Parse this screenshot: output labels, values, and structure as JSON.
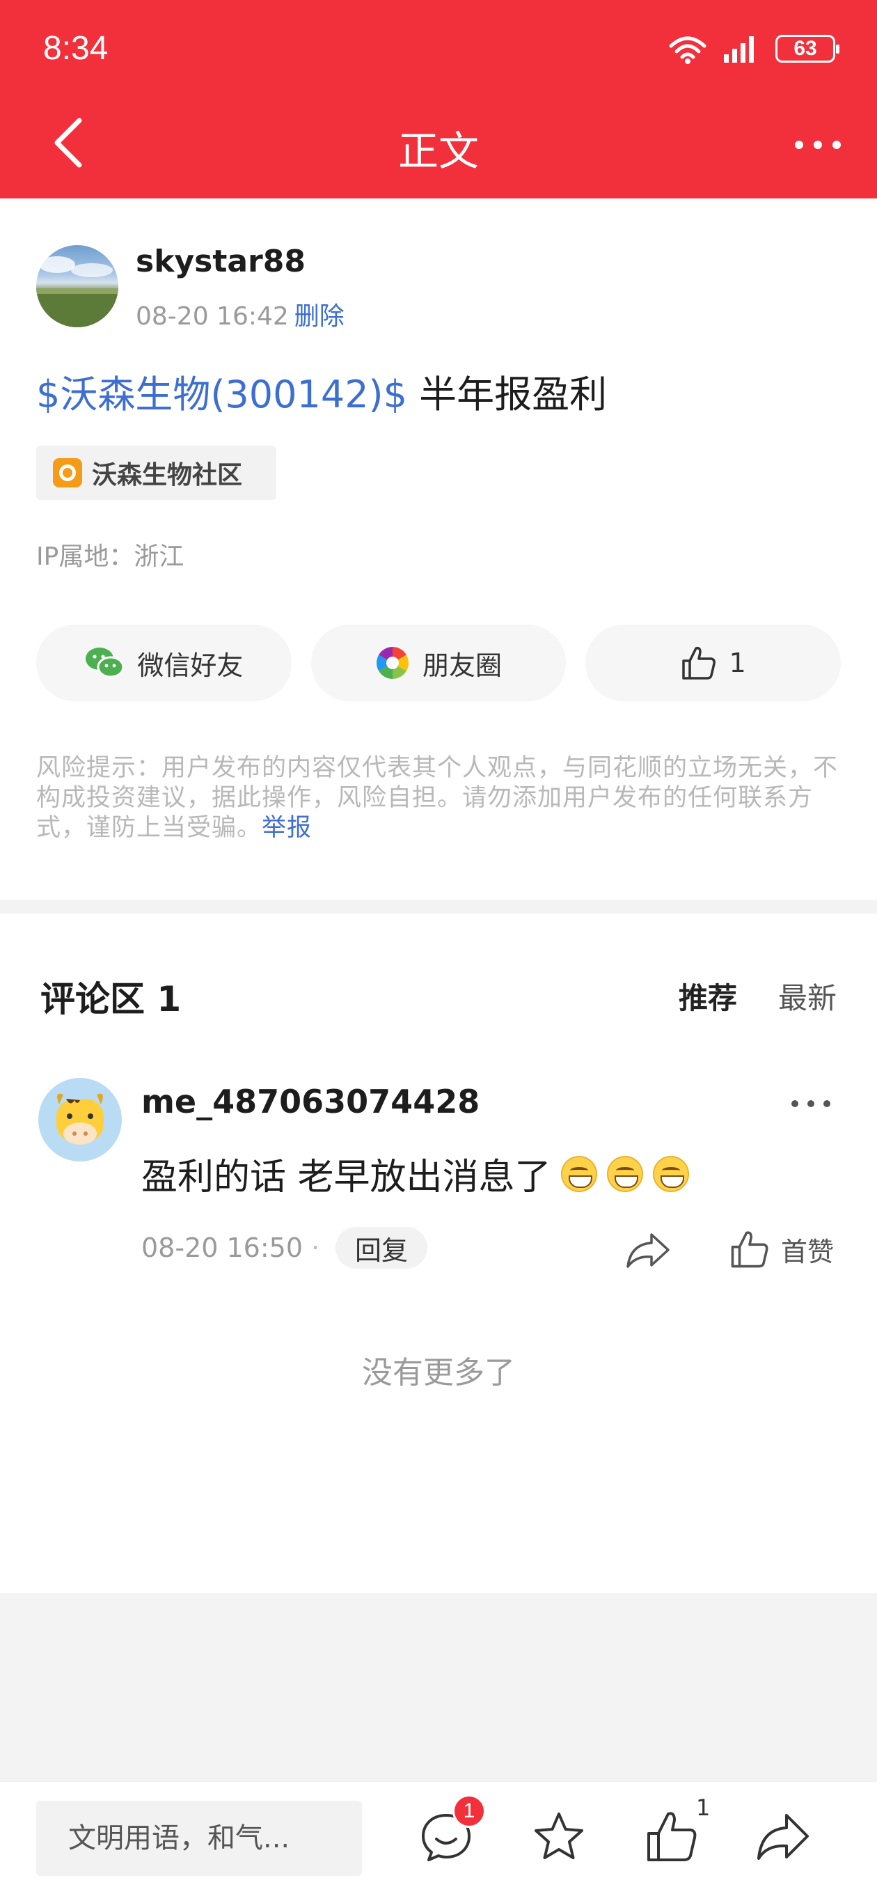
{
  "status_bar": {
    "time": "8:34",
    "battery": "63"
  },
  "nav": {
    "title": "正文"
  },
  "post": {
    "author": "skystar88",
    "date": "08-20 16:42",
    "delete_label": "删除",
    "stock_tag": "$沃森生物(300142)$",
    "title_text": " 半年报盈利",
    "community": "沃森生物社区",
    "ip_location": "IP属地：浙江"
  },
  "share": {
    "wechat": "微信好友",
    "moments": "朋友圈",
    "like_count": "1"
  },
  "risk_notice": {
    "text": "风险提示：用户发布的内容仅代表其个人观点，与同花顺的立场无关，不构成投资建议，据此操作，风险自担。请勿添加用户发布的任何联系方式，谨防上当受骗。",
    "report_label": "举报"
  },
  "comments": {
    "title": "评论区 1",
    "sort_recommended": "推荐",
    "sort_latest": "最新",
    "items": [
      {
        "user": "me_487063074428",
        "text": "盈利的话 老早放出消息了",
        "time": "08-20 16:50",
        "separator": "·",
        "reply_label": "回复",
        "like_label": "首赞"
      }
    ],
    "no_more": "没有更多了"
  },
  "bottom_bar": {
    "input_placeholder": "文明用语，和气...",
    "comment_badge": "1",
    "like_count": "1"
  },
  "colors": {
    "brand_red": "#f2303b",
    "link_blue": "#3d6fd1"
  }
}
